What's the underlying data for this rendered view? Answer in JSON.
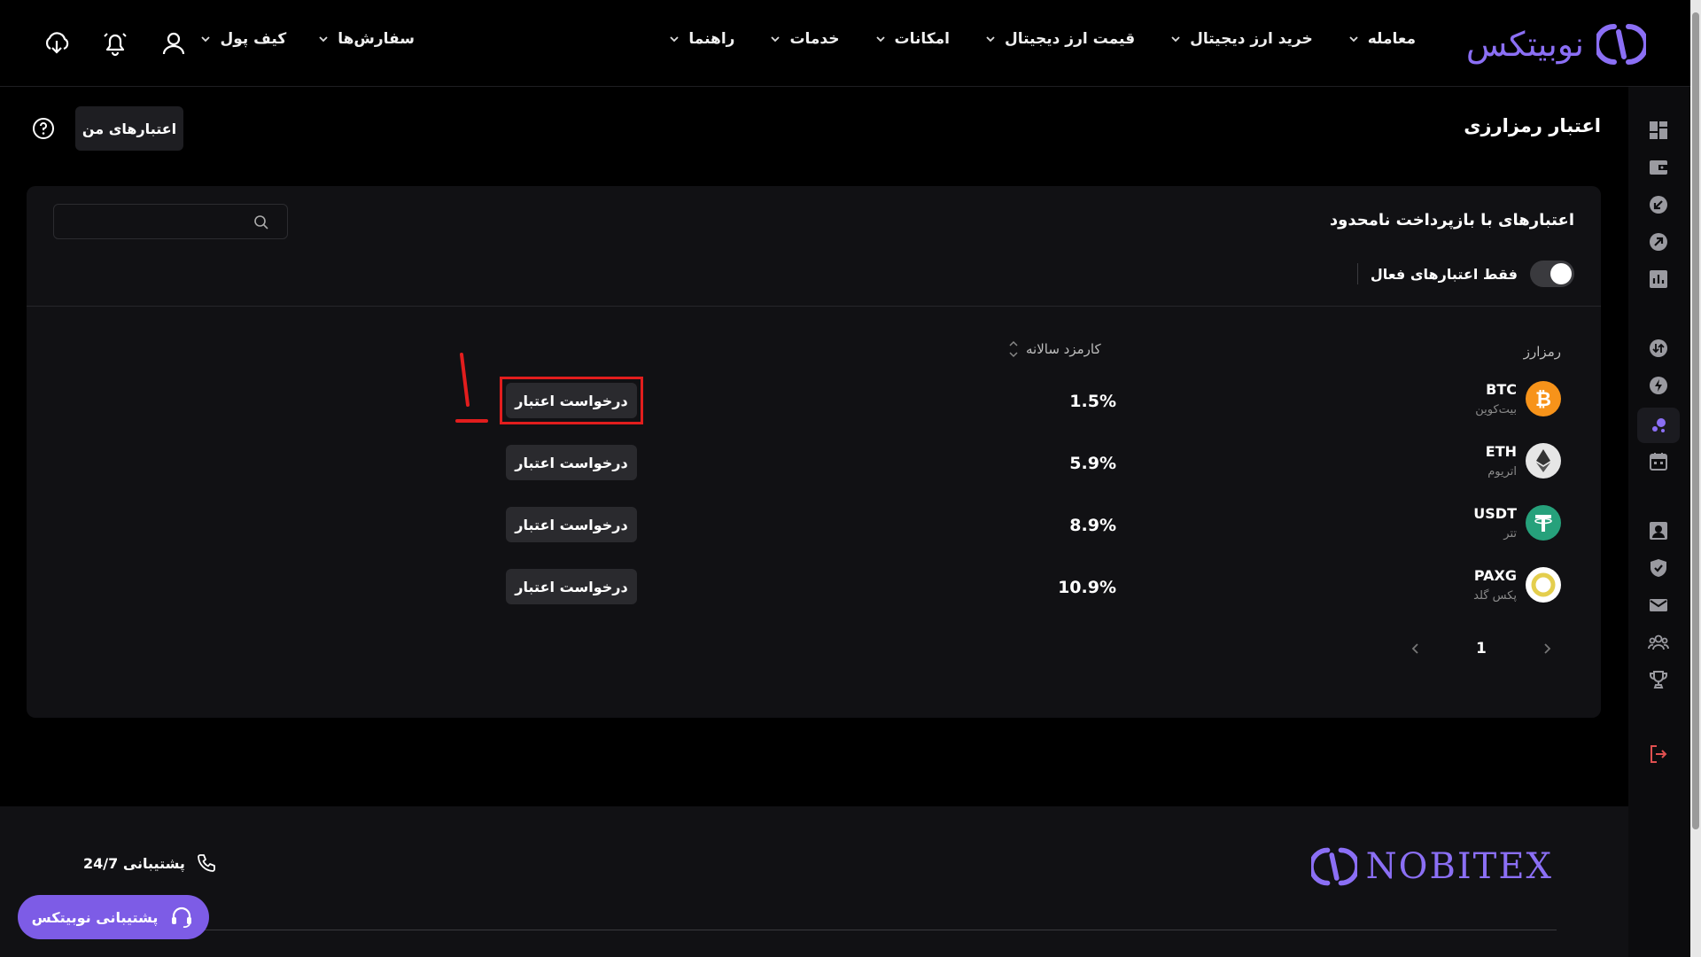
{
  "brand": {
    "name_fa": "نوبیتکس",
    "footer_name": "NOBITEX",
    "accent": "#8b6ff5"
  },
  "nav": {
    "items": [
      "معامله",
      "خرید ارز دیجیتال",
      "قیمت ارز دیجیتال",
      "امکانات",
      "خدمات",
      "راهنما"
    ],
    "left_items": [
      "سفارش‌ها",
      "کیف پول"
    ],
    "icons": [
      "user-icon",
      "bell-icon",
      "download-app-icon"
    ]
  },
  "page": {
    "title": "اعتبار رمزارزی",
    "my_credits_label": "اعتبارهای من"
  },
  "card": {
    "title": "اعتبارهای با بازپرداخت نامحدود",
    "search_placeholder": "",
    "toggle_label": "فقط اعتبارهای فعال",
    "toggle_on": false,
    "columns": {
      "asset": "رمزارز",
      "fee": "کارمزد سالانه"
    },
    "rows": [
      {
        "symbol": "BTC",
        "name": "بیت‌کوین",
        "fee": "1.5%",
        "action": "درخواست اعتبار",
        "color": "#f7931a"
      },
      {
        "symbol": "ETH",
        "name": "اتریوم",
        "fee": "5.9%",
        "action": "درخواست اعتبار",
        "color": "#e6e6e6"
      },
      {
        "symbol": "USDT",
        "name": "تتر",
        "fee": "8.9%",
        "action": "درخواست اعتبار",
        "color": "#26a17b"
      },
      {
        "symbol": "PAXG",
        "name": "پکس گلد",
        "fee": "10.9%",
        "action": "درخواست اعتبار",
        "color": "#e4ce4d"
      }
    ],
    "pagination": {
      "current": "1"
    }
  },
  "annotation": {
    "label": "1",
    "color": "#e21d1d"
  },
  "footer": {
    "support_line": "پشتیبانی 24/7",
    "support_button": "پشتیبانی نوبیتکس"
  }
}
